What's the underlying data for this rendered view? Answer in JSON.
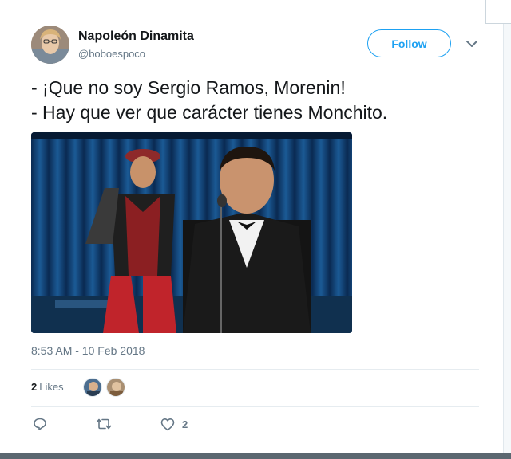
{
  "user": {
    "display_name": "Napoleón Dinamita",
    "handle": "@boboespoco",
    "avatar_icon": "profile-avatar"
  },
  "follow_button": {
    "label": "Follow",
    "color": "#1da1f2"
  },
  "tweet": {
    "lines": [
      "- ¡Que no soy Sergio Ramos, Morenin!",
      "- Hay que ver que carácter tienes Monchito."
    ],
    "media_description_icon": "attached-photo",
    "timestamp": "8:53 AM - 10 Feb 2018"
  },
  "stats": {
    "likes_count": "2",
    "likes_label": "Likes",
    "likers": [
      "liker-avatar-1",
      "liker-avatar-2"
    ]
  },
  "actions": {
    "reply_icon": "reply-icon",
    "retweet_icon": "retweet-icon",
    "like_icon": "heart-icon",
    "like_count": "2"
  },
  "colors": {
    "text": "#14171a",
    "secondary": "#657786",
    "accent": "#1da1f2",
    "divider": "#e6ecf0"
  }
}
